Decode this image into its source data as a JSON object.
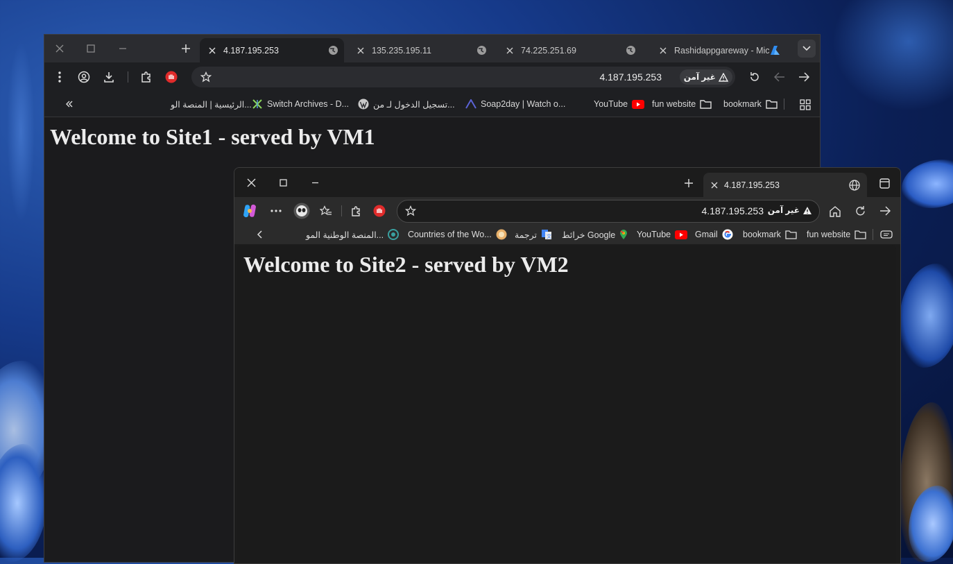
{
  "window1": {
    "tabs": [
      {
        "title": "4.187.195.253",
        "active": true
      },
      {
        "title": "135.235.195.11",
        "active": false
      },
      {
        "title": "74.225.251.69",
        "active": false
      },
      {
        "title": "Rashidappgareway - Microsoft Azure",
        "active": false
      }
    ],
    "address": {
      "url": "4.187.195.253",
      "security_label": "غير آمن"
    },
    "bookmarks": [
      {
        "label": "bookmark",
        "icon": "folder-icon"
      },
      {
        "label": "fun website",
        "icon": "folder-icon"
      },
      {
        "label": "YouTube",
        "icon": "youtube-icon"
      },
      {
        "label": "Soap2day | Watch o...",
        "icon": "soap2day-icon"
      },
      {
        "label": "تسجيل الدخول لـ من...",
        "icon": "wordpress-icon"
      },
      {
        "label": "Switch Archives - D...",
        "icon": "future-icon"
      },
      {
        "label": "الرئيسية | المنصة الو...",
        "icon": ""
      }
    ],
    "page_heading": "Welcome to Site1 - served by VM1"
  },
  "window2": {
    "tab": {
      "title": "4.187.195.253"
    },
    "address": {
      "url": "4.187.195.253",
      "security_label": "غير آمن"
    },
    "bookmarks": [
      {
        "label": "fun website",
        "icon": "folder-icon"
      },
      {
        "label": "bookmark",
        "icon": "folder-icon"
      },
      {
        "label": "Gmail",
        "icon": "google-icon"
      },
      {
        "label": "YouTube",
        "icon": "youtube-icon"
      },
      {
        "label": "خرائط Google",
        "icon": "maps-icon"
      },
      {
        "label": "ترجمة",
        "icon": "translate-icon"
      },
      {
        "label": "Countries of the Wo...",
        "icon": "globe-icon"
      },
      {
        "label": "المنصة الوطنية المو...",
        "icon": "platform-icon"
      }
    ],
    "page_heading": "Welcome to Site2 - served by VM2"
  },
  "colors": {
    "accent_red": "#e02b2b",
    "youtube_red": "#ff0000",
    "azure_blue": "#2f8cf0"
  }
}
